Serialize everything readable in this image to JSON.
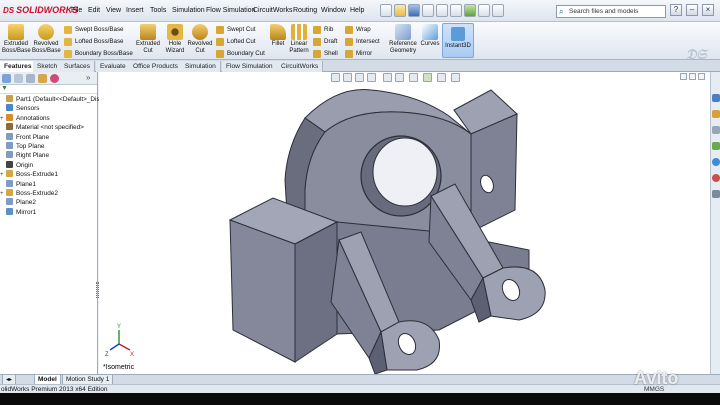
{
  "app": {
    "logo_ds": "DS",
    "logo_text": "SOLIDWORKS",
    "watermark": "Avito"
  },
  "menu": [
    "File",
    "Edit",
    "View",
    "Insert",
    "Tools",
    "Simulation",
    "Flow Simulation",
    "CircuitWorks",
    "Routing",
    "Window",
    "Help"
  ],
  "search": {
    "placeholder": "Search files and models"
  },
  "window_buttons": {
    "help": "?",
    "minimize": "–",
    "close": "×"
  },
  "commands": {
    "extruded_boss": "Extruded Boss/Base",
    "revolved_boss": "Revolved Boss/Base",
    "swept_boss": "Swept Boss/Base",
    "lofted_boss": "Lofted Boss/Base",
    "boundary_boss": "Boundary Boss/Base",
    "extruded_cut": "Extruded Cut",
    "hole_wizard": "Hole Wizard",
    "revolved_cut": "Revolved Cut",
    "swept_cut": "Swept Cut",
    "lofted_cut": "Lofted Cut",
    "boundary_cut": "Boundary Cut",
    "fillet": "Fillet",
    "linear_pattern": "Linear Pattern",
    "rib": "Rib",
    "draft": "Draft",
    "shell": "Shell",
    "wrap": "Wrap",
    "intersect": "Intersect",
    "mirror": "Mirror",
    "reference_geometry": "Reference Geometry",
    "curves": "Curves",
    "instant3d": "Instant3D"
  },
  "tabs": [
    "Features",
    "Sketch",
    "Surfaces",
    "Evaluate",
    "Office Products",
    "Simulation",
    "Flow Simulation",
    "CircuitWorks"
  ],
  "feature_tree": {
    "items": [
      {
        "label": "Part1  (Default<<Default>_Disp",
        "icon": "part-icon",
        "expand": ""
      },
      {
        "label": "Sensors",
        "icon": "sensors-icon",
        "expand": ""
      },
      {
        "label": "Annotations",
        "icon": "annotations-icon",
        "expand": "+"
      },
      {
        "label": "Material <not specified>",
        "icon": "material-icon",
        "expand": ""
      },
      {
        "label": "Front Plane",
        "icon": "plane-icon",
        "expand": ""
      },
      {
        "label": "Top Plane",
        "icon": "plane-icon",
        "expand": ""
      },
      {
        "label": "Right Plane",
        "icon": "plane-icon",
        "expand": ""
      },
      {
        "label": "Origin",
        "icon": "origin-icon",
        "expand": ""
      },
      {
        "label": "Boss-Extrude1",
        "icon": "extrude-icon",
        "expand": "+"
      },
      {
        "label": "Plane1",
        "icon": "plane-icon",
        "expand": ""
      },
      {
        "label": "Boss-Extrude2",
        "icon": "extrude-icon",
        "expand": "+"
      },
      {
        "label": "Plane2",
        "icon": "plane-icon",
        "expand": ""
      },
      {
        "label": "Mirror1",
        "icon": "mirror-icon",
        "expand": ""
      }
    ]
  },
  "viewport": {
    "view_label": "*Isometric"
  },
  "triad": {
    "x": "X",
    "y": "Y",
    "z": "Z"
  },
  "bottom_tabs": [
    "Model",
    "Motion Study 1"
  ],
  "status": {
    "text": "olidWorks Premium 2013 x64 Edition",
    "units": "MMGS"
  },
  "colors": {
    "model_face_light": "#9ea1b2",
    "model_face_mid": "#7f8294",
    "model_face_dark": "#5d6072",
    "accent_blue": "#2a5aa8"
  }
}
